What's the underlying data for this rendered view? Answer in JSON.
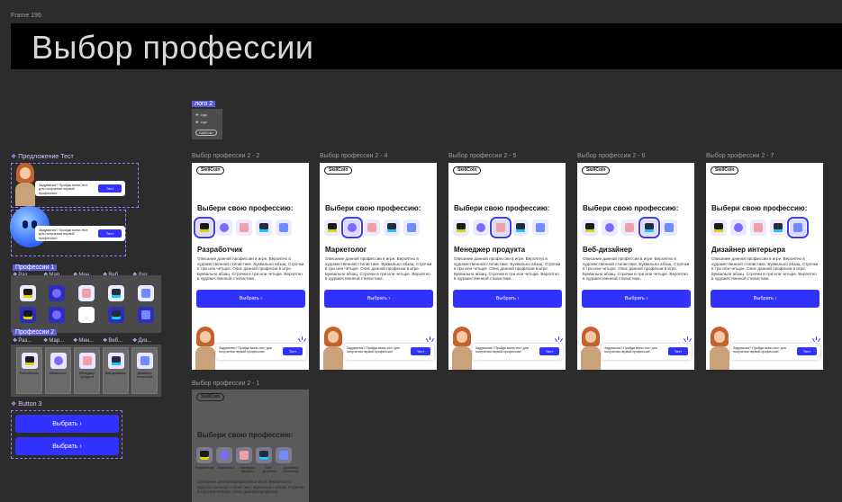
{
  "canvas": {
    "frame_label": "Frame 196",
    "title": "Выбор профессии"
  },
  "logo_component": {
    "label": "лого 2",
    "rows": [
      "logo",
      "logo"
    ],
    "pill": "SkillCoin"
  },
  "offer_component": {
    "label": "Предложение Тест",
    "bubble_text": "Задумался? Пройди мини-тест для получения первой профессии!",
    "button": "Тест"
  },
  "professions1": {
    "label": "Профессии 1",
    "sublabels": [
      "Раз...",
      "Мар...",
      "Мен...",
      "Веб...",
      "Диз..."
    ]
  },
  "professions2": {
    "label": "Профессии 2",
    "sublabels": [
      "Раз...",
      "Мар...",
      "Мен...",
      "Веб...",
      "Диз..."
    ],
    "cards": [
      "Разработчик",
      "Маркетолог",
      "Менеджер продукта",
      "Веб-дизайнер",
      "Дизайнер интерьера"
    ]
  },
  "button3": {
    "label": "Button 3",
    "buttons": [
      "Выбрать ›",
      "Выбрать ›"
    ]
  },
  "screens": [
    {
      "frame": "Выбор профессии 2 - 2",
      "role": "Разработчик",
      "selected": 0
    },
    {
      "frame": "Выбор профессии 2 - 4",
      "role": "Маркетолог",
      "selected": 1
    },
    {
      "frame": "Выбор профессии 2 - 5",
      "role": "Менеджер продукта",
      "selected": 2
    },
    {
      "frame": "Выбор профессии 2 - 6",
      "role": "Веб-дизайнер",
      "selected": 3
    },
    {
      "frame": "Выбор профессии 2 - 7",
      "role": "Дизайнер интерьера",
      "selected": 4
    }
  ],
  "screen_common": {
    "logo": "SkillCoin",
    "question": "Выбери свою профессию:",
    "description": "Описание данной профессии в игре. Вероятно в художественной стилистике. Буквально абзац. Строчки в три или четыре. Опис данной професии в игре. Буквально абзац. Строчки в три или четыре. Вероятно в художественной стилистике.",
    "button": "Выбрать ›",
    "bubble_text": "Задумался? Пройди мини-тест для получения первой профессии!",
    "bubble_button": "Тест"
  },
  "dim_screen": {
    "frame": "Выбор профессии 2 - 1",
    "logo": "SkillCoin",
    "question": "Выбери свою профессию:",
    "labels": [
      "Разработчик",
      "Маркетолог",
      "Менеджер продукта",
      "Веб-дизайнер",
      "Дизайнер интерьера"
    ],
    "description": "Описание данной профессии в игре. Вероятно в художественной стилистике. Буквально абзац. Строчки в три или четыре. Опис данной професии"
  },
  "colors": {
    "accent": "#3232ff",
    "canvas": "#2c2c2c",
    "banner": "#000000",
    "component_label": "#c9c9ff"
  }
}
